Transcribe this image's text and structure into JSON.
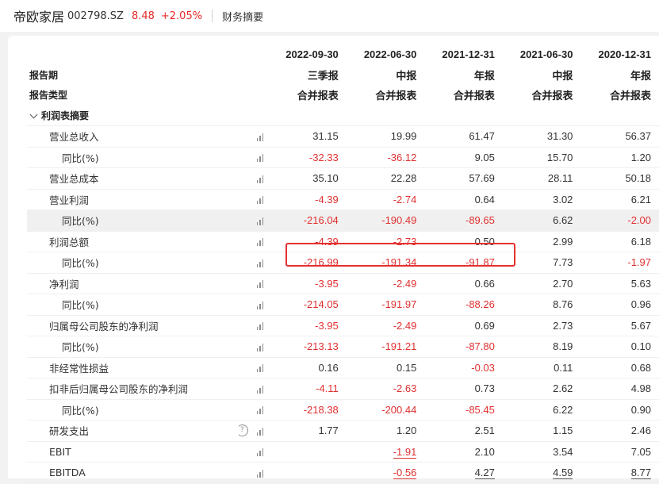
{
  "header": {
    "company": "帝欧家居",
    "code": "002798.SZ",
    "price": "8.48",
    "change": "+2.05%",
    "tab": "财务摘要"
  },
  "colors": {
    "negative": "#e03030",
    "highlight_box": "#e53030"
  },
  "table": {
    "periods": [
      "2022-09-30",
      "2022-06-30",
      "2021-12-31",
      "2021-06-30",
      "2020-12-31"
    ],
    "period_row_label": "报告期",
    "period_types": [
      "三季报",
      "中报",
      "年报",
      "中报",
      "年报"
    ],
    "type_row_label": "报告类型",
    "statement_types": [
      "合并报表",
      "合并报表",
      "合并报表",
      "合并报表",
      "合并报表"
    ],
    "section_label": "利润表摘要",
    "rows": [
      {
        "label": "营业总收入",
        "values": [
          "31.15",
          "19.99",
          "61.47",
          "31.30",
          "56.37"
        ]
      },
      {
        "label": "同比(%)",
        "values": [
          "-32.33",
          "-36.12",
          "9.05",
          "15.70",
          "1.20"
        ]
      },
      {
        "label": "营业总成本",
        "values": [
          "35.10",
          "22.28",
          "57.69",
          "28.11",
          "50.18"
        ]
      },
      {
        "label": "营业利润",
        "values": [
          "-4.39",
          "-2.74",
          "0.64",
          "3.02",
          "6.21"
        ]
      },
      {
        "label": "同比(%)",
        "values": [
          "-216.04",
          "-190.49",
          "-89.65",
          "6.62",
          "-2.00"
        ]
      },
      {
        "label": "利润总额",
        "values": [
          "-4.39",
          "-2.73",
          "0.50",
          "2.99",
          "6.18"
        ]
      },
      {
        "label": "同比(%)",
        "values": [
          "-216.99",
          "-191.34",
          "-91.87",
          "7.73",
          "-1.97"
        ]
      },
      {
        "label": "净利润",
        "values": [
          "-3.95",
          "-2.49",
          "0.66",
          "2.70",
          "5.63"
        ]
      },
      {
        "label": "同比(%)",
        "values": [
          "-214.05",
          "-191.97",
          "-88.26",
          "8.76",
          "0.96"
        ]
      },
      {
        "label": "归属母公司股东的净利润",
        "values": [
          "-3.95",
          "-2.49",
          "0.69",
          "2.73",
          "5.67"
        ]
      },
      {
        "label": "同比(%)",
        "values": [
          "-213.13",
          "-191.21",
          "-87.80",
          "8.19",
          "0.10"
        ]
      },
      {
        "label": "非经常性损益",
        "values": [
          "0.16",
          "0.15",
          "-0.03",
          "0.11",
          "0.68"
        ]
      },
      {
        "label": "扣非后归属母公司股东的净利润",
        "values": [
          "-4.11",
          "-2.63",
          "0.73",
          "2.62",
          "4.98"
        ]
      },
      {
        "label": "同比(%)",
        "values": [
          "-218.38",
          "-200.44",
          "-85.45",
          "6.22",
          "0.90"
        ]
      },
      {
        "label": "研发支出",
        "help_icon": "?",
        "values": [
          "1.77",
          "1.20",
          "2.51",
          "1.15",
          "2.46"
        ]
      },
      {
        "label": "EBIT",
        "values": [
          "",
          "-1.91",
          "2.10",
          "3.54",
          "7.05"
        ]
      },
      {
        "label": "EBITDA",
        "values": [
          "",
          "-0.56",
          "4.27",
          "4.59",
          "8.77"
        ]
      }
    ]
  }
}
